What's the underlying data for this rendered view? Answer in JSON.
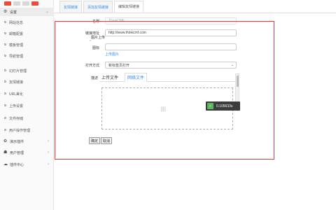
{
  "colors": {
    "accent": "#3a8ee6",
    "frame": "#e53935",
    "badge_bg": "#3c3c3c",
    "badge_leaf": "#5cb85c"
  },
  "sidebar": {
    "items": [
      {
        "label": "设置",
        "type": "parent",
        "icon": "gear-icon"
      },
      {
        "label": "网站信息",
        "type": "child"
      },
      {
        "label": "邮箱配置",
        "type": "child"
      },
      {
        "label": "模板管理",
        "type": "child"
      },
      {
        "label": "导航管理",
        "type": "child"
      },
      {
        "label": "幻灯片管理",
        "type": "child"
      },
      {
        "label": "友情链接",
        "type": "child"
      },
      {
        "label": "URL美化",
        "type": "child"
      },
      {
        "label": "上传设置",
        "type": "child"
      },
      {
        "label": "文件存储",
        "type": "child"
      },
      {
        "label": "用户操作管理",
        "type": "child"
      },
      {
        "label": "演示插件",
        "type": "parent",
        "icon": "plugin-icon"
      },
      {
        "label": "用户管理",
        "type": "parent",
        "icon": "users-icon"
      },
      {
        "label": "插件中心",
        "type": "parent",
        "icon": "cloud-icon"
      }
    ]
  },
  "tabs": [
    {
      "label": "友情链接"
    },
    {
      "label": "添加友情链接"
    },
    {
      "label": "编辑友情链接"
    }
  ],
  "form": {
    "name_label": "名称",
    "name_value": "ThinkCMF",
    "url_label": "链接地址",
    "url_value": "http://www.thinkcmf.com",
    "upload_image_label": "图片上传",
    "icon_label": "图标",
    "upload_image_link": "上传图片",
    "open_mode_label": "打开方式",
    "open_mode_value": "新标签页打开",
    "desc_label": "描述",
    "editor_tab_upload": "上传文件",
    "editor_tab_web": "网络文件",
    "confirm": "确定",
    "cancel": "取消"
  },
  "speed_badge": {
    "value": "0.105633s"
  }
}
